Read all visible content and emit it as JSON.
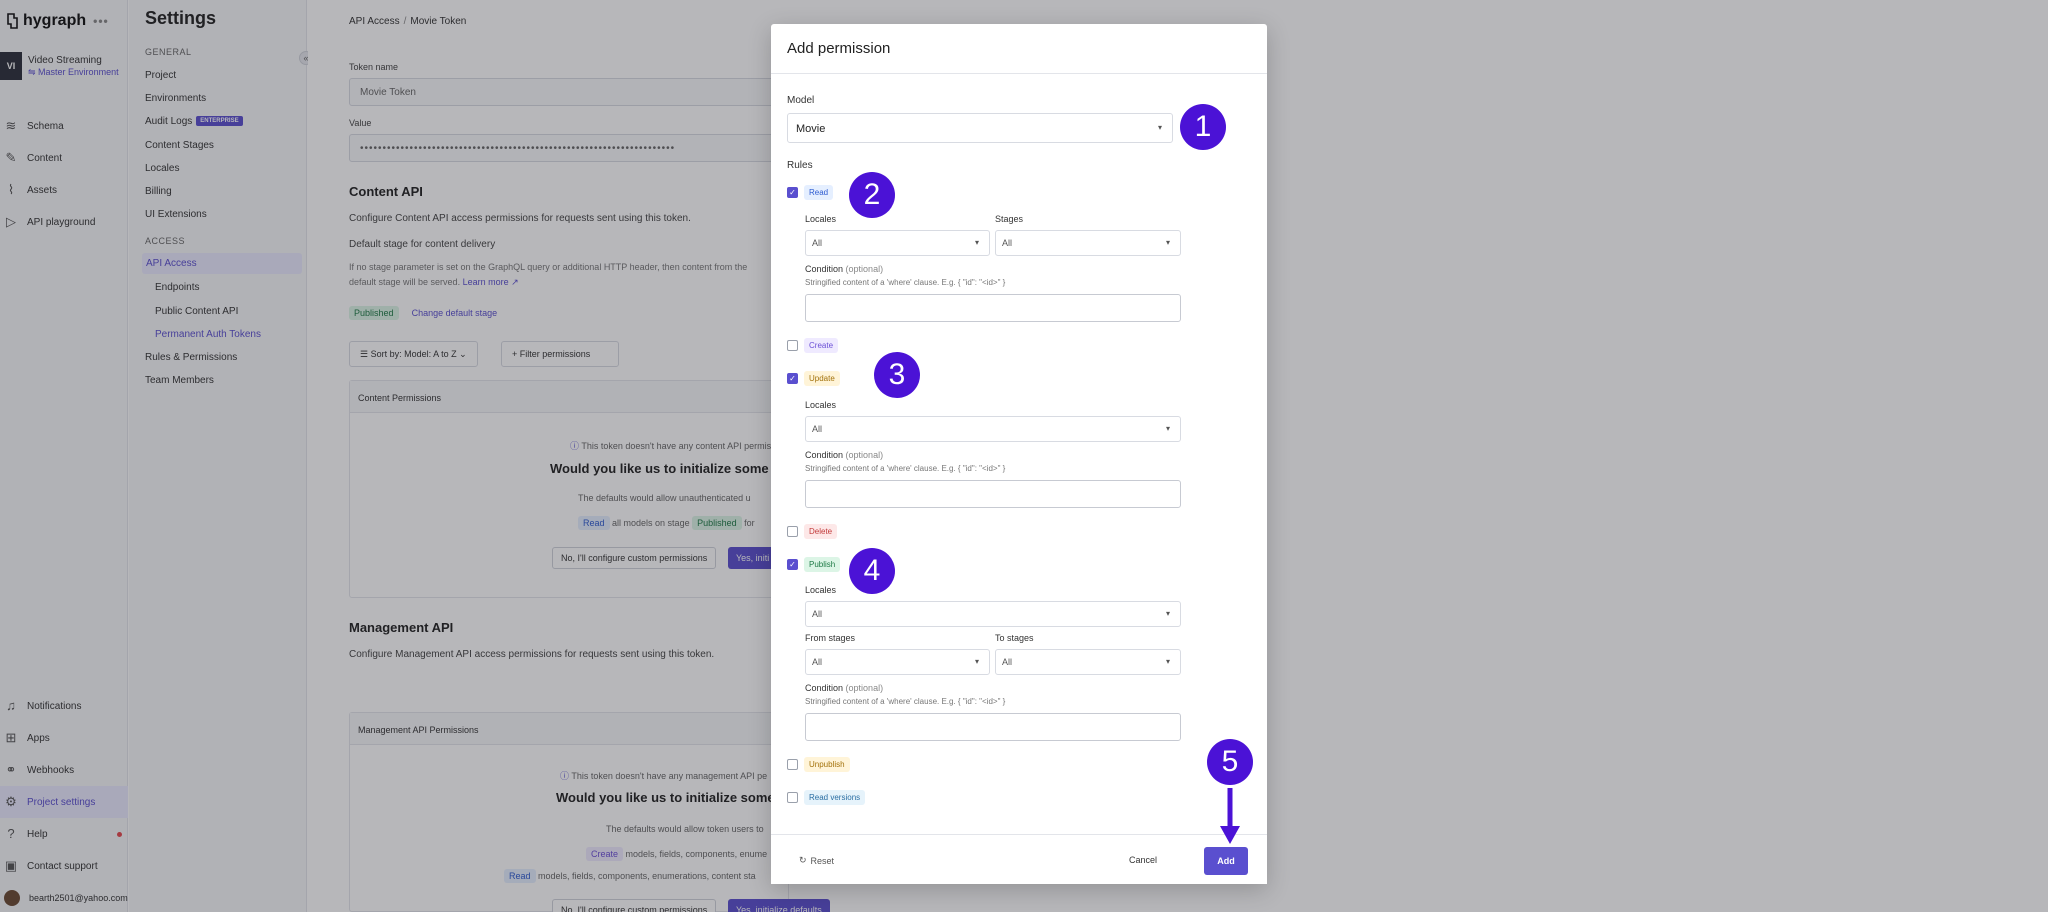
{
  "app": {
    "brand": "hygraph",
    "brand_more": "•••",
    "project_initials": "VI",
    "project_name": "Video Streaming",
    "project_env": "Master Environment"
  },
  "leftnav": {
    "items": [
      {
        "label": "Schema",
        "icon": "layers-icon"
      },
      {
        "label": "Content",
        "icon": "edit-icon"
      },
      {
        "label": "Assets",
        "icon": "paperclip-icon"
      },
      {
        "label": "API playground",
        "icon": "play-icon"
      }
    ],
    "bottom": [
      {
        "label": "Notifications",
        "icon": "bell-icon"
      },
      {
        "label": "Apps",
        "icon": "apps-icon"
      },
      {
        "label": "Webhooks",
        "icon": "webhook-icon"
      },
      {
        "label": "Project settings",
        "icon": "gear-icon"
      },
      {
        "label": "Help",
        "icon": "help-icon"
      },
      {
        "label": "Contact support",
        "icon": "chat-icon"
      },
      {
        "label": "bearth2501@yahoo.com",
        "icon": "avatar"
      }
    ]
  },
  "settings": {
    "title": "Settings",
    "general_head": "GENERAL",
    "general": [
      "Project",
      "Environments",
      "Audit Logs",
      "Content Stages",
      "Locales",
      "Billing",
      "UI Extensions"
    ],
    "enterprise_badge": "ENTERPRISE",
    "access_head": "ACCESS",
    "access": [
      "API Access",
      "Endpoints",
      "Public Content API",
      "Permanent Auth Tokens",
      "Rules & Permissions",
      "Team Members"
    ]
  },
  "main": {
    "breadcrumb_parent": "API Access",
    "breadcrumb_sep": "/",
    "breadcrumb_current": "Movie Token",
    "token_name_label": "Token name",
    "token_name_value": "Movie Token",
    "value_label": "Value",
    "value_masked": "••••••••••••••••••••••••••••••••••••••••••••••••••••••••••••••••••••••",
    "content_api_title": "Content API",
    "content_api_desc": "Configure Content API access permissions for requests sent using this token.",
    "default_stage_label": "Default stage for content delivery",
    "default_stage_desc1": "If no stage parameter is set on the GraphQL query or additional HTTP header, then content from the",
    "default_stage_desc2": "default stage will be served.",
    "learn_more": "Learn more",
    "stage_badge": "Published",
    "change_stage": "Change default stage",
    "sort_label": "Sort by: Model: A to Z",
    "filter_label": "Filter permissions",
    "content_permissions_head": "Content Permissions",
    "content_no_perm": "This token doesn't have any content API permis",
    "content_init_q": "Would you like us to initialize some d",
    "content_defaults": "The defaults would allow unauthenticated u",
    "content_read_badge": "Read",
    "content_all_models": "all models on stage",
    "content_published_badge": "Published",
    "content_for": "for",
    "content_no_btn": "No, I'll configure custom permissions",
    "content_yes_btn": "Yes, initi",
    "mgmt_api_title": "Management API",
    "mgmt_api_desc": "Configure Management API access permissions for requests sent using this token.",
    "mgmt_permissions_head": "Management API Permissions",
    "mgmt_no_perm": "This token doesn't have any management API pe",
    "mgmt_init_q": "Would you like us to initialize some d",
    "mgmt_defaults": "The defaults would allow token users to",
    "mgmt_create_badge": "Create",
    "mgmt_create_text": "models, fields, components, enume",
    "mgmt_read_badge": "Read",
    "mgmt_read_text": "models, fields, components, enumerations, content sta",
    "mgmt_no_btn": "No, I'll configure custom permissions",
    "mgmt_yes_btn": "Yes, initialize defaults"
  },
  "modal": {
    "title": "Add permission",
    "model_label": "Model",
    "model_value": "Movie",
    "rules_label": "Rules",
    "rules": {
      "read": {
        "label": "Read",
        "checked": true
      },
      "create": {
        "label": "Create",
        "checked": false
      },
      "update": {
        "label": "Update",
        "checked": true
      },
      "delete": {
        "label": "Delete",
        "checked": false
      },
      "publish": {
        "label": "Publish",
        "checked": true
      },
      "unpublish": {
        "label": "Unpublish",
        "checked": false
      },
      "read_versions": {
        "label": "Read versions",
        "checked": false
      }
    },
    "locales_label": "Locales",
    "stages_label": "Stages",
    "from_stages_label": "From stages",
    "to_stages_label": "To stages",
    "all_value": "All",
    "condition_label": "Condition",
    "optional": "(optional)",
    "condition_hint": "Stringified content of a 'where' clause. E.g. { \"id\": \"<id>\" }",
    "reset": "Reset",
    "cancel": "Cancel",
    "add": "Add"
  },
  "annotations": [
    "1",
    "2",
    "3",
    "4",
    "5"
  ],
  "colors": {
    "accent": "#5a4fcf",
    "annotation": "#4b12d6"
  }
}
